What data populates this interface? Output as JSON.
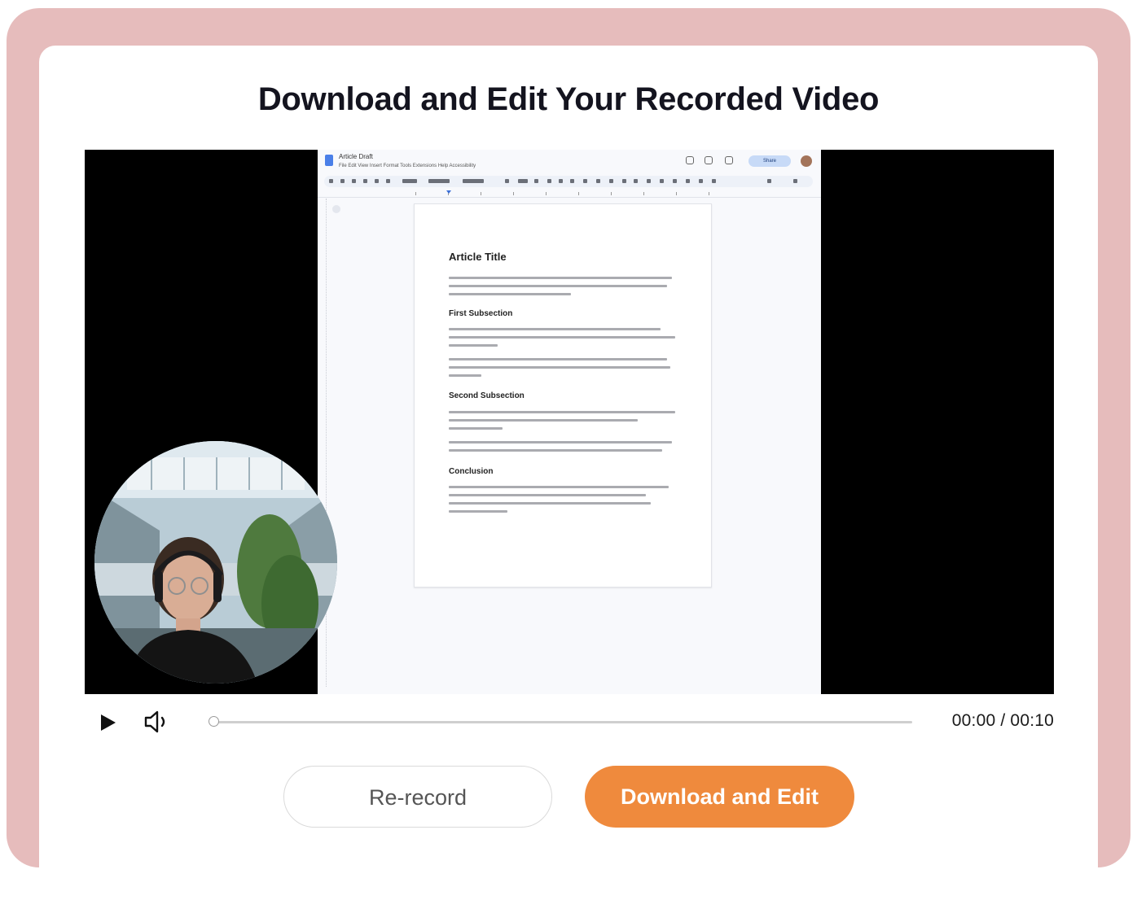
{
  "title": "Download and Edit Your Recorded Video",
  "video": {
    "doc": {
      "name": "Article Draft",
      "menu": "File  Edit  View  Insert  Format  Tools  Extensions  Help  Accessibility",
      "share_label": "Share",
      "heading": "Article Title",
      "sections": [
        {
          "heading": "First Subsection"
        },
        {
          "heading": "Second Subsection"
        },
        {
          "heading": "Conclusion"
        }
      ]
    },
    "controls": {
      "time": "00:00 / 00:10",
      "progress": 0
    }
  },
  "buttons": {
    "rerecord": "Re-record",
    "download": "Download and Edit"
  },
  "colors": {
    "frame": "#e6bcbc",
    "accent": "#ef8a3d"
  }
}
